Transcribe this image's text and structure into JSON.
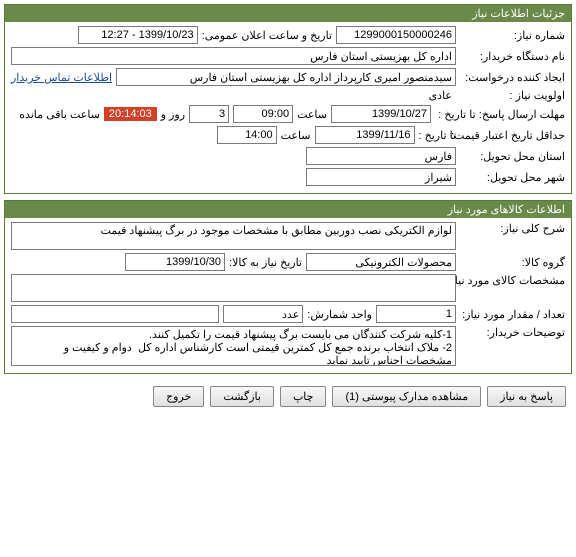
{
  "panel1": {
    "title": "جزئیات اطلاعات نیاز",
    "need_no_label": "شماره نیاز:",
    "need_no": "1299000150000246",
    "public_announce_label": "تاریخ و ساعت اعلان عمومی:",
    "public_announce": "1399/10/23 - 12:27",
    "buyer_org_label": "نام دستگاه خریدار:",
    "buyer_org": "اداره کل بهزیستی استان فارس",
    "creator_label": "ایجاد کننده درخواست:",
    "creator": "سیدمنصور امیری کارپرداز اداره کل بهزیستی استان فارس",
    "contact_link": "اطلاعات تماس خریدار",
    "priority_label": "اولویت نیاز :",
    "priority": "عادی",
    "deadline_label": "مهلت ارسال پاسخ:  تا تاریخ :",
    "deadline_date": "1399/10/27",
    "time_label": "ساعت",
    "deadline_time": "09:00",
    "days_count": "3",
    "days_label": "روز و",
    "countdown": "20:14:03",
    "remain_label": "ساعت باقی مانده",
    "min_valid_label": "حداقل تاریخ اعتبار قیمت:",
    "to_date_label": "تا تاریخ :",
    "min_valid_date": "1399/11/16",
    "min_valid_time": "14:00",
    "province_label": "استان محل تحویل:",
    "province": "فارس",
    "city_label": "شهر محل تحویل:",
    "city": "شیراز"
  },
  "panel2": {
    "title": "اطلاعات کالاهای مورد نیاز",
    "gen_desc_label": "شرح کلی نیاز:",
    "gen_desc": "لوازم الکتریکی نصب دوربین مطابق با مشخصات موجود در برگ پیشنهاد قیمت",
    "group_label": "گروه کالا:",
    "group": "محصولات الکترونیکی",
    "need_by_label": "تاریخ نیاز به کالا:",
    "need_by": "1399/10/30",
    "specs_label": "مشخصات کالای مورد نیاز:",
    "specs": "",
    "qty_label": "تعداد / مقدار مورد نیاز:",
    "qty": "1",
    "unit_label": "واحد شمارش:",
    "unit": "عدد",
    "notes_label": "توضیحات خریدار:",
    "notes": "1-کلیه شرکت کنندگان می بایست برگ پیشنهاد قیمت را تکمیل کنند.\n2- ملاک انتخاب برنده جمع کل کمترین قیمتی است کارشناس اداره کل  دوام و کیفیت و مشخصات اجناس تایید نماید"
  },
  "buttons": {
    "reply": "پاسخ به نیاز",
    "attachments": "مشاهده مدارک پیوستی (1)",
    "print": "چاپ",
    "back": "بازگشت",
    "exit": "خروج"
  }
}
